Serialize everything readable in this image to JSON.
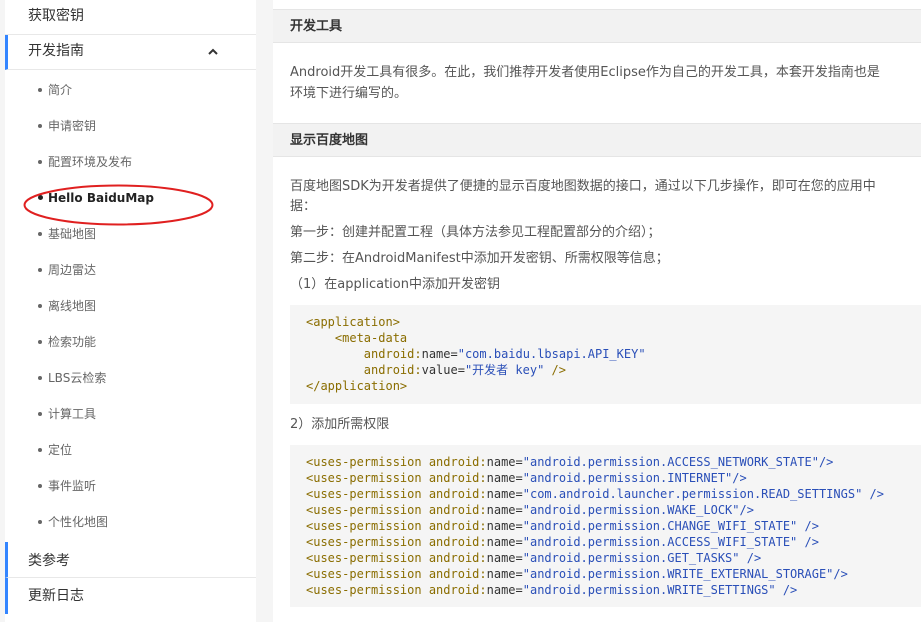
{
  "sidebar": {
    "get_key": "获取密钥",
    "dev_guide": "开发指南",
    "items": [
      "简介",
      "申请密钥",
      "配置环境及发布",
      "Hello BaiduMap",
      "基础地图",
      "周边雷达",
      "离线地图",
      "检索功能",
      "LBS云检索",
      "计算工具",
      "定位",
      "事件监听",
      "个性化地图"
    ],
    "class_ref": "类参考",
    "changelog": "更新日志"
  },
  "content": {
    "sec1_title": "开发工具",
    "sec1_p1": "Android开发工具有很多。在此，我们推荐开发者使用Eclipse作为自己的开发工具，本套开发指南也是",
    "sec1_p2": "环境下进行编写的。",
    "sec2_title": "显示百度地图",
    "sec2_p1": "百度地图SDK为开发者提供了便捷的显示百度地图数据的接口，通过以下几步操作，即可在您的应用中",
    "sec2_p2": "据：",
    "step1": "第一步：创建并配置工程（具体方法参见工程配置部分的介绍）；",
    "step2": "第二步：在AndroidManifest中添加开发密钥、所需权限等信息；",
    "sub1": "（1）在application中添加开发密钥",
    "sub2": "2）添加所需权限"
  },
  "code1": {
    "line1": "<application>",
    "line2": "<meta-data",
    "line3_ns": "android:",
    "line3_attr": "name=",
    "line3_val": "\"com.baidu.lbsapi.API_KEY\"",
    "line4_ns": "android:",
    "line4_attr": "value=",
    "line4_val": "\"开发者 key\"",
    "line4_end": " />",
    "line5": "</application>"
  },
  "code2": {
    "permissions": [
      "\"android.permission.ACCESS_NETWORK_STATE\"/>",
      "\"android.permission.INTERNET\"/>",
      "\"com.android.launcher.permission.READ_SETTINGS\" />",
      "\"android.permission.WAKE_LOCK\"/>",
      "\"android.permission.CHANGE_WIFI_STATE\" />",
      "\"android.permission.ACCESS_WIFI_STATE\" />",
      "\"android.permission.GET_TASKS\" />",
      "\"android.permission.WRITE_EXTERNAL_STORAGE\"/>",
      "\"android.permission.WRITE_SETTINGS\" />"
    ],
    "tag": "<uses-permission ",
    "ns": "android:",
    "attr": "name="
  },
  "colors": {
    "accent": "#3385ff",
    "highlight": "#e02020",
    "string": "#2a4fb8",
    "tag": "#8a6d00"
  },
  "icons": {
    "expand": "chevron-up-icon"
  }
}
